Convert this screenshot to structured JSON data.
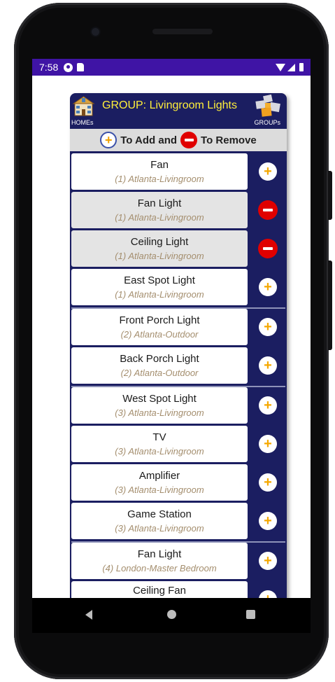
{
  "status": {
    "time": "7:58"
  },
  "header": {
    "title": "GROUP: Livingroom Lights",
    "home_label": "HOMEs",
    "groups_label": "GROUPs"
  },
  "instructions": {
    "add_text": "To Add and",
    "remove_text": "To Remove",
    "add_glyph": "+"
  },
  "colors": {
    "statusbar": "#3f14a5",
    "panel": "#1b1e61",
    "title": "#ffef3a",
    "room_text": "#a48e6e",
    "add_plus": "#f5a800",
    "remove": "#e00000"
  },
  "devices": [
    {
      "name": "Fan",
      "room": "(1) Atlanta-Livingroom",
      "in_group": false,
      "icon": "add-icon"
    },
    {
      "name": "Fan Light",
      "room": "(1) Atlanta-Livingroom",
      "in_group": true,
      "icon": "remove-icon"
    },
    {
      "name": "Ceiling Light",
      "room": "(1) Atlanta-Livingroom",
      "in_group": true,
      "icon": "remove-icon"
    },
    {
      "name": "East Spot Light",
      "room": "(1) Atlanta-Livingroom",
      "in_group": false,
      "icon": "add-icon"
    },
    {
      "name": "Front Porch Light",
      "room": "(2) Atlanta-Outdoor",
      "in_group": false,
      "icon": "add-icon"
    },
    {
      "name": "Back Porch Light",
      "room": "(2) Atlanta-Outdoor",
      "in_group": false,
      "icon": "add-icon"
    },
    {
      "name": "West Spot Light",
      "room": "(3) Atlanta-Livingroom",
      "in_group": false,
      "icon": "add-icon"
    },
    {
      "name": "TV",
      "room": "(3) Atlanta-Livingroom",
      "in_group": false,
      "icon": "add-icon"
    },
    {
      "name": "Amplifier",
      "room": "(3) Atlanta-Livingroom",
      "in_group": false,
      "icon": "add-icon"
    },
    {
      "name": "Game Station",
      "room": "(3) Atlanta-Livingroom",
      "in_group": false,
      "icon": "add-icon"
    },
    {
      "name": "Fan Light",
      "room": "(4) London-Master Bedroom",
      "in_group": false,
      "icon": "add-icon"
    },
    {
      "name": "Ceiling Fan",
      "room": "",
      "in_group": false,
      "icon": "add-icon"
    }
  ]
}
